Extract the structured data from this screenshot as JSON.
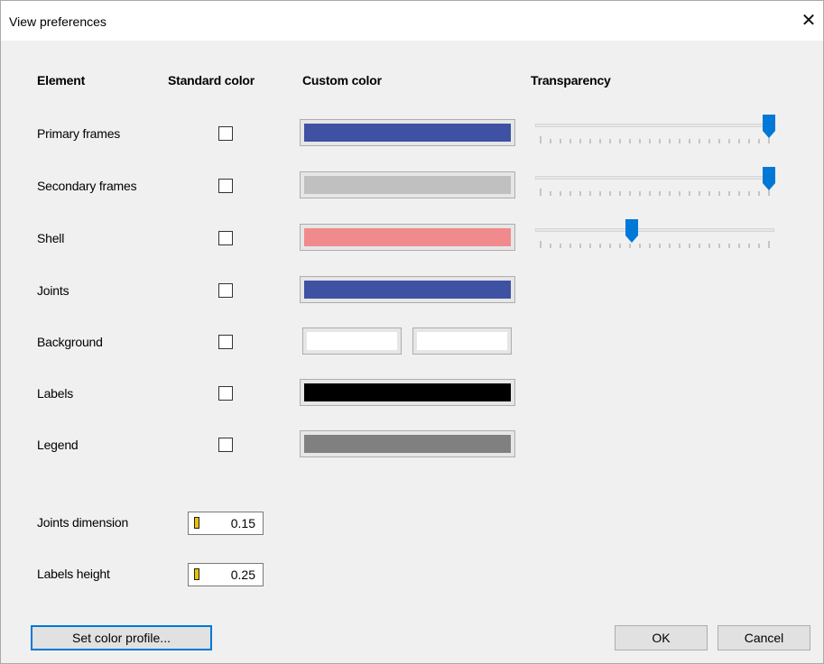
{
  "window": {
    "title": "View preferences",
    "close_icon": "close-icon"
  },
  "headers": {
    "element": "Element",
    "standard_color": "Standard color",
    "custom_color": "Custom color",
    "transparency": "Transparency"
  },
  "rows": [
    {
      "label": "Primary frames",
      "standard_checked": false,
      "color": "#3f51a3"
    },
    {
      "label": "Secondary frames",
      "standard_checked": false,
      "color": "#c0c0c0"
    },
    {
      "label": "Shell",
      "standard_checked": false,
      "color": "#f08a8c"
    },
    {
      "label": "Joints",
      "standard_checked": false,
      "color": "#3f51a3"
    },
    {
      "label": "Background",
      "standard_checked": false,
      "color_1": "#ffffff",
      "color_2": "#ffffff"
    },
    {
      "label": "Labels",
      "standard_checked": false,
      "color": "#000000"
    },
    {
      "label": "Legend",
      "standard_checked": false,
      "color": "#808080"
    }
  ],
  "transparency": [
    {
      "row": "Primary frames",
      "value_fraction": 1.0
    },
    {
      "row": "Secondary frames",
      "value_fraction": 1.0
    },
    {
      "row": "Shell",
      "value_fraction": 0.4
    }
  ],
  "fields": {
    "joints_dimension": {
      "label": "Joints dimension",
      "value": "0.15"
    },
    "labels_height": {
      "label": "Labels height",
      "value": "0.25"
    }
  },
  "buttons": {
    "set_color_profile": "Set color profile...",
    "ok": "OK",
    "cancel": "Cancel"
  },
  "colors": {
    "accent": "#0078d7"
  }
}
